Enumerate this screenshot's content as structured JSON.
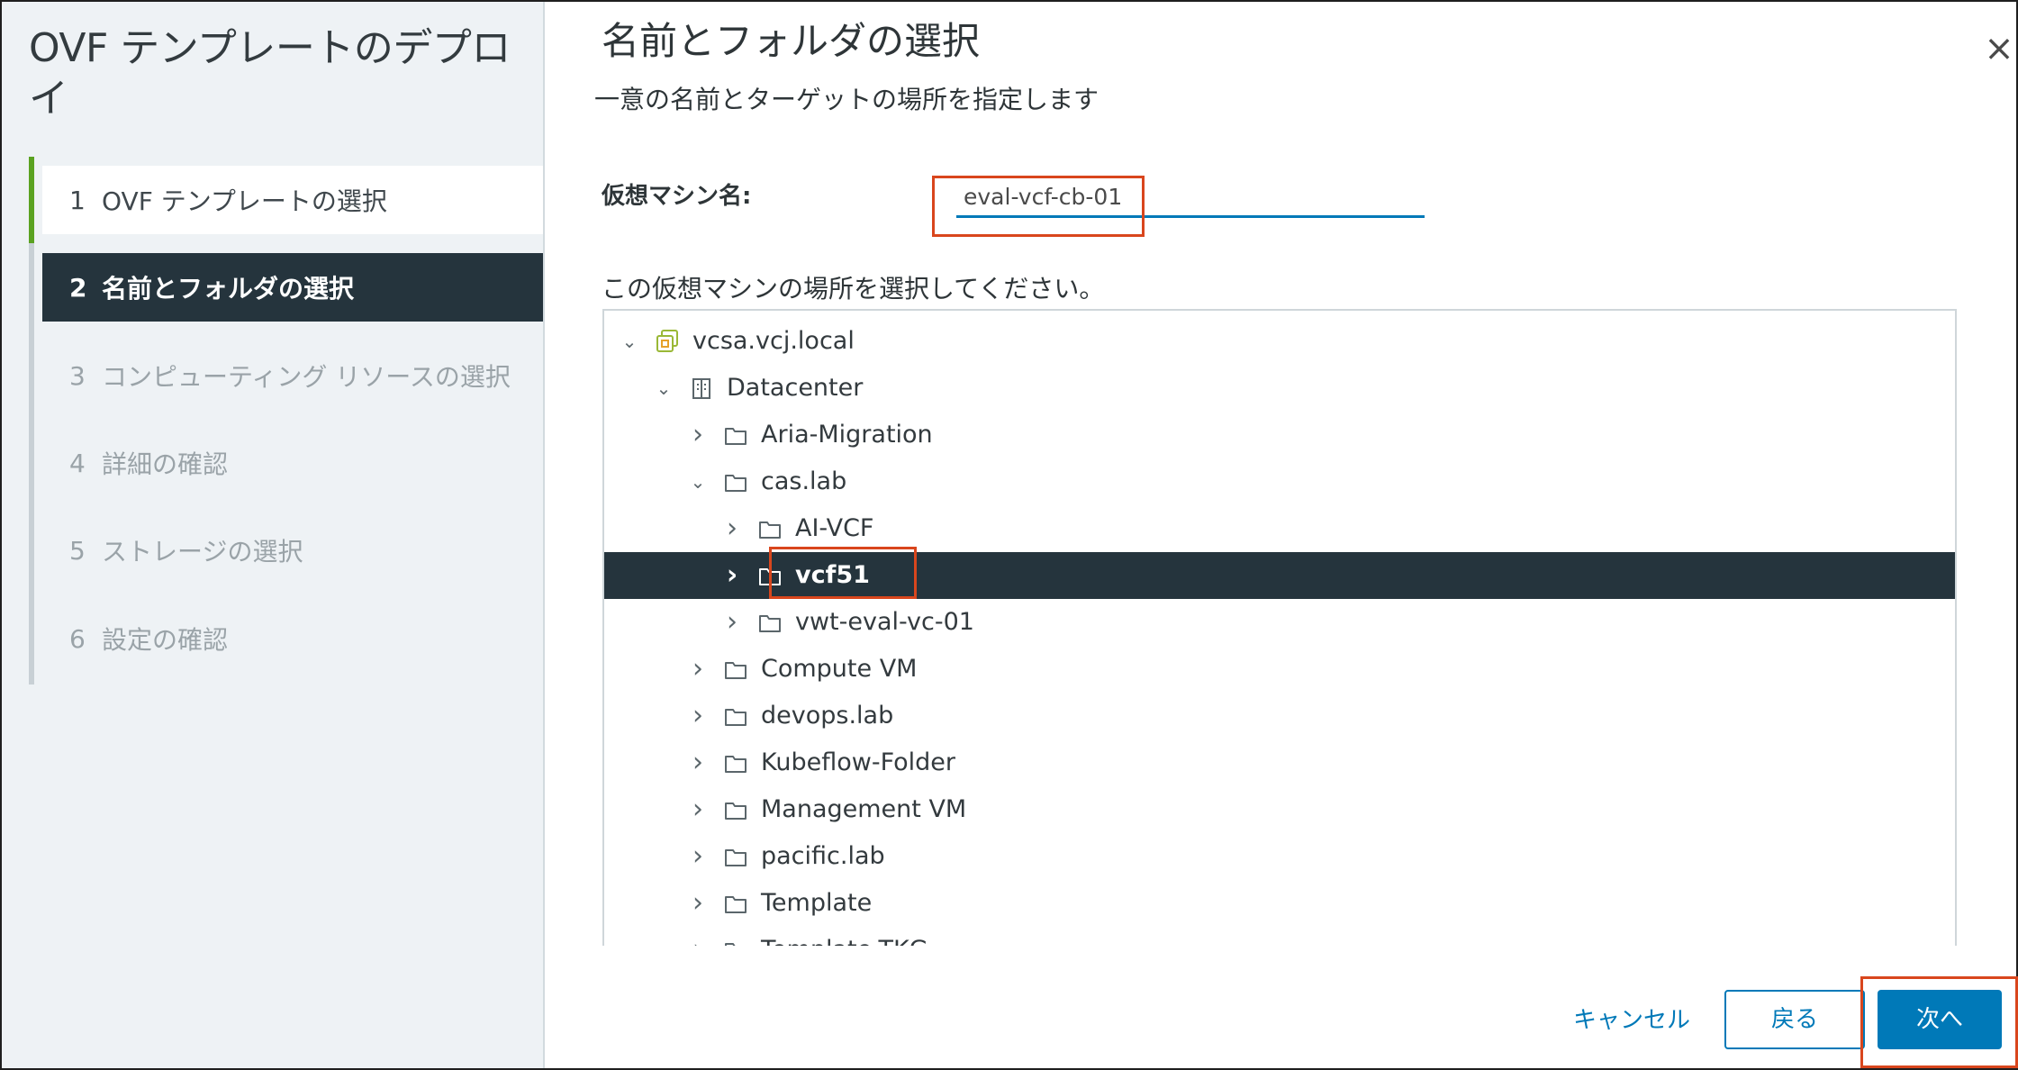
{
  "wizard": {
    "title": "OVF テンプレートのデプロイ",
    "steps": [
      {
        "num": "1",
        "label": "OVF テンプレートの選択",
        "state": "done"
      },
      {
        "num": "2",
        "label": "名前とフォルダの選択",
        "state": "active"
      },
      {
        "num": "3",
        "label": "コンピューティング リソースの選択",
        "state": "pending"
      },
      {
        "num": "4",
        "label": "詳細の確認",
        "state": "pending"
      },
      {
        "num": "5",
        "label": "ストレージの選択",
        "state": "pending"
      },
      {
        "num": "6",
        "label": "設定の確認",
        "state": "pending"
      }
    ]
  },
  "page": {
    "title": "名前とフォルダの選択",
    "subtitle": "一意の名前とターゲットの場所を指定します",
    "close_glyph": "×"
  },
  "vm_name": {
    "label": "仮想マシン名:",
    "value": "eval-vcf-cb-01"
  },
  "location": {
    "label": "この仮想マシンの場所を選択してください。",
    "tree": [
      {
        "label": "vcsa.vcj.local",
        "icon": "vcenter-icon",
        "expanded": true,
        "depth": 0
      },
      {
        "label": "Datacenter",
        "icon": "datacenter-icon",
        "expanded": true,
        "depth": 1
      },
      {
        "label": "Aria-Migration",
        "icon": "folder-icon",
        "expanded": false,
        "depth": 2
      },
      {
        "label": "cas.lab",
        "icon": "folder-icon",
        "expanded": true,
        "depth": 2
      },
      {
        "label": "AI-VCF",
        "icon": "folder-icon",
        "expanded": false,
        "depth": 3
      },
      {
        "label": "vcf51",
        "icon": "folder-icon",
        "expanded": false,
        "depth": 3,
        "selected": true
      },
      {
        "label": "vwt-eval-vc-01",
        "icon": "folder-icon",
        "expanded": false,
        "depth": 3
      },
      {
        "label": "Compute VM",
        "icon": "folder-icon",
        "expanded": false,
        "depth": 2
      },
      {
        "label": "devops.lab",
        "icon": "folder-icon",
        "expanded": false,
        "depth": 2
      },
      {
        "label": "Kubeflow-Folder",
        "icon": "folder-icon",
        "expanded": false,
        "depth": 2
      },
      {
        "label": "Management VM",
        "icon": "folder-icon",
        "expanded": false,
        "depth": 2
      },
      {
        "label": "pacific.lab",
        "icon": "folder-icon",
        "expanded": false,
        "depth": 2
      },
      {
        "label": "Template",
        "icon": "folder-icon",
        "expanded": false,
        "depth": 2
      },
      {
        "label": "Template-TKG",
        "icon": "folder-icon",
        "expanded": false,
        "depth": 2
      }
    ]
  },
  "footer": {
    "cancel_label": "キャンセル",
    "back_label": "戻る",
    "next_label": "次へ"
  },
  "colors": {
    "accent": "#0079b8",
    "selected_bg": "#25343d",
    "step_done_bar": "#5aa220",
    "highlight_box": "#d9461d"
  }
}
